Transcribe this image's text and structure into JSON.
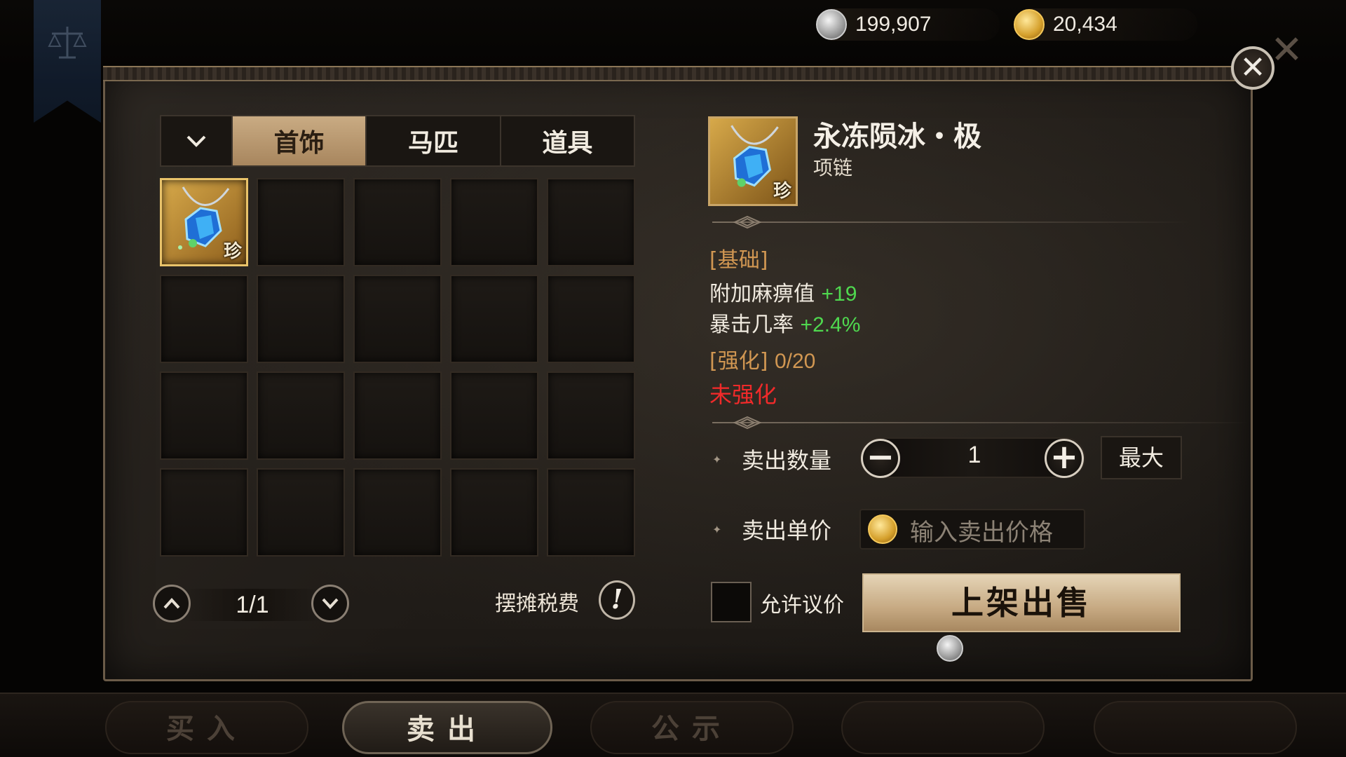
{
  "currency": {
    "silver_amount": "199,907",
    "gold_amount": "20,434"
  },
  "tabs": [
    {
      "label": "首饰",
      "active": true
    },
    {
      "label": "马匹",
      "active": false
    },
    {
      "label": "道具",
      "active": false
    }
  ],
  "inventory": {
    "slots_total": 20,
    "items": [
      {
        "slot": 0,
        "rarity_mark": "珍",
        "icon": "ice-necklace-icon"
      }
    ]
  },
  "pager": {
    "text": "1/1"
  },
  "tax": {
    "label": "摆摊税费",
    "icon_text": "!"
  },
  "detail": {
    "name": "永冻陨冰・极",
    "type": "项链",
    "rarity_mark": "珍",
    "basic_header": "[基础]",
    "stats": [
      {
        "name": "附加麻痹值",
        "value": "+19"
      },
      {
        "name": "暴击几率",
        "value": "+2.4%"
      }
    ],
    "enhance_header": "[强化]",
    "enhance_value": "0/20",
    "enhance_status": "未强化"
  },
  "sell": {
    "quantity_label": "卖出数量",
    "quantity_value": "1",
    "minus_symbol": "−",
    "plus_symbol": "+",
    "max_label": "最大",
    "price_label": "卖出单价",
    "price_placeholder": "输入卖出价格",
    "allow_bargain_label": "允许议价",
    "allow_bargain_checked": false,
    "list_button": "上架出售"
  },
  "bottom_tabs": [
    {
      "label": "买入",
      "active": false
    },
    {
      "label": "卖出",
      "active": true
    },
    {
      "label": "公示",
      "active": false
    }
  ],
  "colors": {
    "stat_value": "#4fd84f",
    "section_header": "#d19752",
    "warning": "#f02a2a",
    "active_tab": "#c9ab83"
  }
}
